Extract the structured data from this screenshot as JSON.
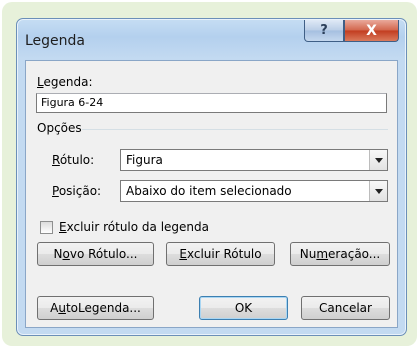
{
  "window": {
    "title": "Legenda",
    "help_glyph": "?",
    "close_glyph": "X"
  },
  "legend_label": {
    "first": "L",
    "rest": "egenda:"
  },
  "legend_value": "Figura 6-24",
  "options_label": "Opções",
  "label_field": {
    "first": "R",
    "rest": "ótulo:",
    "value": "Figura"
  },
  "position_field": {
    "first": "P",
    "rest": "osição:",
    "value": "Abaixo do item selecionado"
  },
  "exclude_checkbox": {
    "first": "E",
    "rest": "xcluir rótulo da legenda",
    "checked": false
  },
  "buttons": {
    "new_label": {
      "pre": "N",
      "u": "o",
      "post": "vo Rótulo..."
    },
    "delete_label": {
      "pre": "",
      "u": "E",
      "post": "xcluir Rótulo"
    },
    "numbering": {
      "pre": "Nu",
      "u": "m",
      "post": "eração..."
    },
    "autolegend": {
      "pre": "A",
      "u": "u",
      "post": "toLegenda..."
    },
    "ok": "OK",
    "cancel": "Cancelar"
  },
  "colors": {
    "frame_bg": "#e7f1da",
    "title_bar": "#b4d0ee",
    "close_button": "#c23c1f",
    "default_button_border": "#3c7fb1"
  }
}
